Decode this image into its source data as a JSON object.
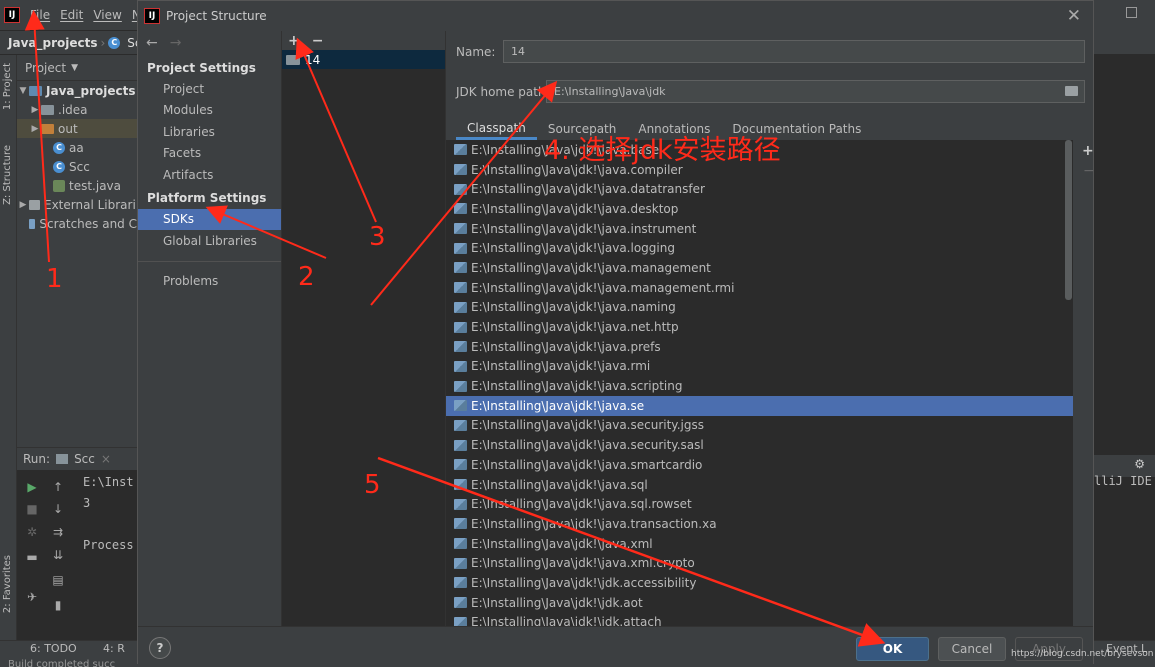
{
  "ide": {
    "logo": "IJ",
    "menu": [
      "File",
      "Edit",
      "View",
      "N"
    ],
    "navbar": {
      "project": "Java_projects",
      "class": "Scc"
    },
    "left_strip": {
      "project": "1: Project",
      "structure": "Z: Structure",
      "favorites": "2: Favorites"
    },
    "project_panel": {
      "header": "Project",
      "tree": [
        {
          "label": "Java_projects",
          "depth": 0
        },
        {
          "label": ".idea",
          "depth": 1
        },
        {
          "label": "out",
          "depth": 1
        },
        {
          "label": "aa",
          "depth": 2
        },
        {
          "label": "Scc",
          "depth": 2
        },
        {
          "label": "test.java",
          "depth": 2
        },
        {
          "label": "External Librari",
          "depth": 0
        },
        {
          "label": "Scratches and C",
          "depth": 0
        }
      ]
    },
    "run": {
      "label": "Run:",
      "tab": "Scc",
      "console": [
        "E:\\Inst",
        "3",
        "",
        "Process"
      ]
    },
    "right_text": "lliJ IDE",
    "bottom_tabs": {
      "todo": "6: TODO",
      "run": "4: R",
      "event": "Event L"
    },
    "status": "Build completed succ"
  },
  "dialog": {
    "title": "Project Structure",
    "sidebar": {
      "project_settings_header": "Project Settings",
      "project_settings": [
        "Project",
        "Modules",
        "Libraries",
        "Facets",
        "Artifacts"
      ],
      "platform_settings_header": "Platform Settings",
      "platform_settings": [
        "SDKs",
        "Global Libraries"
      ],
      "problems": "Problems"
    },
    "sdk_list": {
      "items": [
        "14"
      ]
    },
    "detail": {
      "name_label": "Name:",
      "name_value": "14",
      "jdk_label": "JDK home path:",
      "jdk_value": "E:\\Installing\\Java\\jdk",
      "tabs": [
        "Classpath",
        "Sourcepath",
        "Annotations",
        "Documentation Paths"
      ],
      "classpath": [
        "E:\\Installing\\Java\\jdk!\\java.base",
        "E:\\Installing\\Java\\jdk!\\java.compiler",
        "E:\\Installing\\Java\\jdk!\\java.datatransfer",
        "E:\\Installing\\Java\\jdk!\\java.desktop",
        "E:\\Installing\\Java\\jdk!\\java.instrument",
        "E:\\Installing\\Java\\jdk!\\java.logging",
        "E:\\Installing\\Java\\jdk!\\java.management",
        "E:\\Installing\\Java\\jdk!\\java.management.rmi",
        "E:\\Installing\\Java\\jdk!\\java.naming",
        "E:\\Installing\\Java\\jdk!\\java.net.http",
        "E:\\Installing\\Java\\jdk!\\java.prefs",
        "E:\\Installing\\Java\\jdk!\\java.rmi",
        "E:\\Installing\\Java\\jdk!\\java.scripting",
        "E:\\Installing\\Java\\jdk!\\java.se",
        "E:\\Installing\\Java\\jdk!\\java.security.jgss",
        "E:\\Installing\\Java\\jdk!\\java.security.sasl",
        "E:\\Installing\\Java\\jdk!\\java.smartcardio",
        "E:\\Installing\\Java\\jdk!\\java.sql",
        "E:\\Installing\\Java\\jdk!\\java.sql.rowset",
        "E:\\Installing\\Java\\jdk!\\java.transaction.xa",
        "E:\\Installing\\Java\\jdk!\\java.xml",
        "E:\\Installing\\Java\\jdk!\\java.xml.crypto",
        "E:\\Installing\\Java\\jdk!\\jdk.accessibility",
        "E:\\Installing\\Java\\jdk!\\jdk.aot",
        "E:\\Installing\\Java\\jdk!\\jdk.attach"
      ]
    },
    "footer": {
      "help": "?",
      "ok": "OK",
      "cancel": "Cancel",
      "apply": "Apply"
    },
    "watermark": "https://blog.csdn.net/brysevson"
  },
  "annotations": {
    "n1": "1",
    "n2": "2",
    "n3": "3",
    "n4": "4. 选择jdk安装路径",
    "n5": "5"
  },
  "colors": {
    "selection": "#4b6eaf",
    "annotation": "#ff2a1a",
    "ok_button": "#365880"
  }
}
